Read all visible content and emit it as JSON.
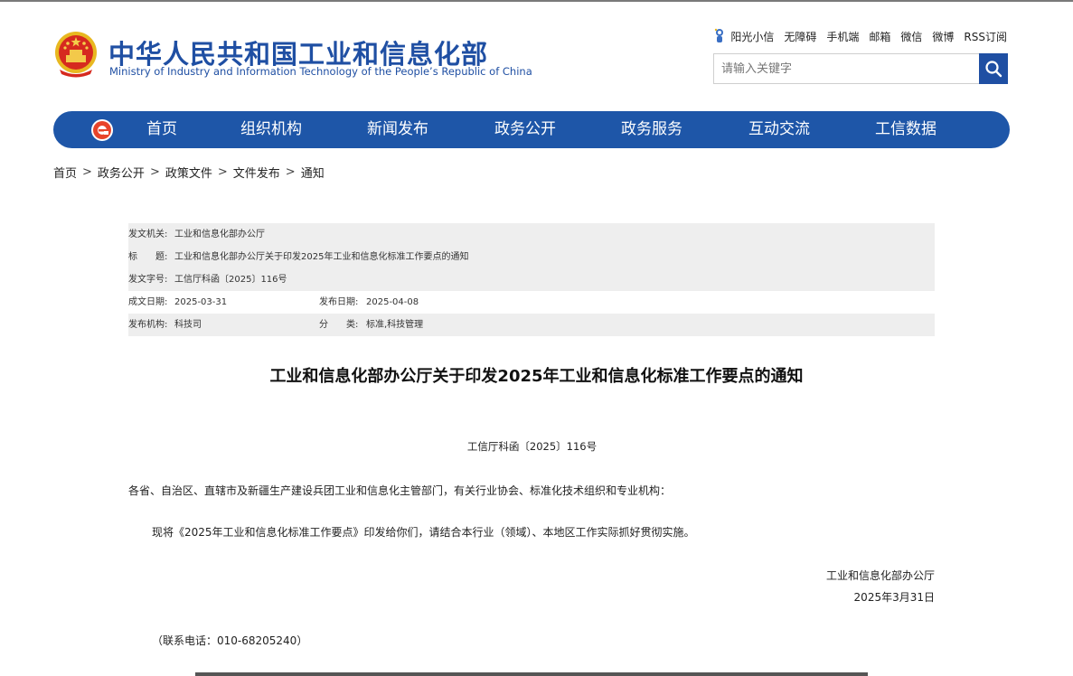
{
  "site": {
    "title_cn": "中华人民共和国工业和信息化部",
    "title_en": "Ministry of Industry and Information Technology of the People’s Republic of China"
  },
  "top_links": [
    "阳光小信",
    "无障碍",
    "手机端",
    "邮箱",
    "微信",
    "微博",
    "RSS订阅"
  ],
  "search": {
    "placeholder": "请输入关键字"
  },
  "nav": {
    "items": [
      "首页",
      "组织机构",
      "新闻发布",
      "政务公开",
      "政务服务",
      "互动交流",
      "工信数据"
    ]
  },
  "breadcrumb": [
    "首页",
    "政务公开",
    "政策文件",
    "文件发布",
    "通知"
  ],
  "info": {
    "issuer_label": "发文机关:",
    "issuer": "工业和信息化部办公厅",
    "title_label": "标　　题:",
    "title": "工业和信息化部办公厅关于印发2025年工业和信息化标准工作要点的通知",
    "doc_no_label": "发文字号:",
    "doc_no": "工信厅科函〔2025〕116号",
    "created_label": "成文日期:",
    "created": "2025-03-31",
    "published_label": "发布日期:",
    "published": "2025-04-08",
    "org_label": "发布机构:",
    "org": "科技司",
    "category_label": "分　　类:",
    "category": "标准,科技管理"
  },
  "document": {
    "title": "工业和信息化部办公厅关于印发2025年工业和信息化标准工作要点的通知",
    "number": "工信厅科函〔2025〕116号",
    "salutation": "各省、自治区、直辖市及新疆生产建设兵团工业和信息化主管部门，有关行业协会、标准化技术组织和专业机构：",
    "body": "现将《2025年工业和信息化标准工作要点》印发给你们，请结合本行业（领域）、本地区工作实际抓好贯彻实施。",
    "signer": "工业和信息化部办公厅",
    "date": "2025年3月31日",
    "contact": "（联系电话：010-68205240）"
  },
  "colors": {
    "brand_blue": "#1f4fa3",
    "nav_blue": "#1e56a8",
    "row_shade": "#eeeeee"
  },
  "icons": [
    "national-emblem-icon",
    "sun-mascot-icon",
    "search-icon",
    "e-gov-logo-icon"
  ]
}
